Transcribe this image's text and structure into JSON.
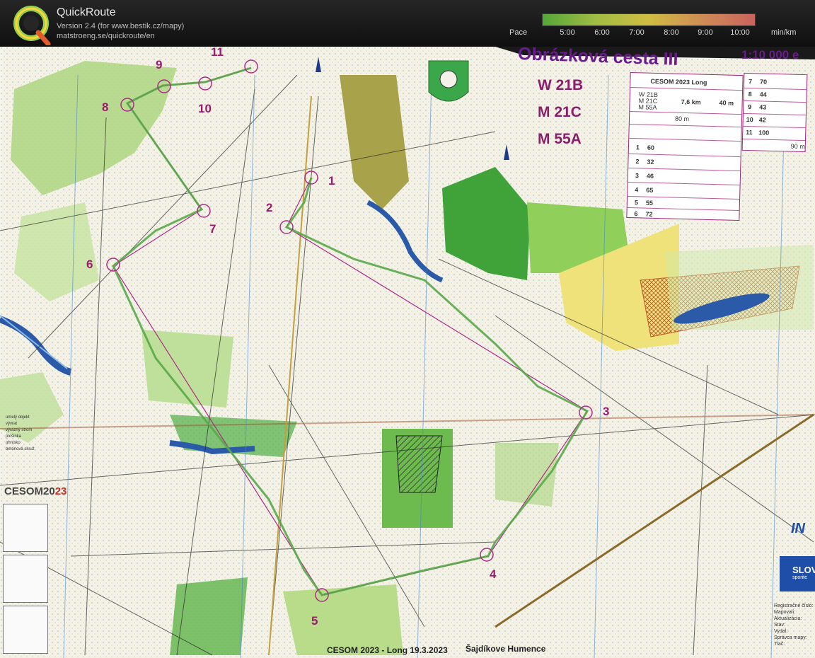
{
  "header": {
    "app_name": "QuickRoute",
    "version": "Version 2.4  (for www.bestik.cz/mapy)",
    "url": "matstroeng.se/quickroute/en",
    "pace_label": "Pace",
    "pace_unit": "min/km",
    "pace_ticks": [
      "5:00",
      "6:00",
      "7:00",
      "8:00",
      "9:00",
      "10:00"
    ],
    "pace_colors": [
      "#5fbf3f",
      "#b8d94a",
      "#f0d94a",
      "#f0a060",
      "#e8706a"
    ]
  },
  "map": {
    "title": "Obrázková cesta III",
    "scale": "1:10 000 e",
    "classes": [
      "W 21B",
      "M 21C",
      "M 55A"
    ],
    "course": {
      "header": "CESOM 2023 Long",
      "classes_small": [
        "W 21B",
        "M 21C",
        "M 55A"
      ],
      "length": "7,6 km",
      "climb": "40 m",
      "start_dist": "80 m",
      "controls": [
        {
          "n": "1",
          "code": "60"
        },
        {
          "n": "2",
          "code": "32"
        },
        {
          "n": "3",
          "code": "46"
        },
        {
          "n": "4",
          "code": "65"
        },
        {
          "n": "5",
          "code": "55"
        },
        {
          "n": "6",
          "code": "72"
        }
      ],
      "controls2": [
        {
          "n": "7",
          "code": "70"
        },
        {
          "n": "8",
          "code": "44"
        },
        {
          "n": "9",
          "code": "43"
        },
        {
          "n": "10",
          "code": "42"
        },
        {
          "n": "11",
          "code": "100"
        }
      ],
      "finish_dist": "90 m"
    },
    "control_numbers": [
      "1",
      "2",
      "3",
      "4",
      "5",
      "6",
      "7",
      "8",
      "9",
      "10",
      "11"
    ],
    "legend": [
      "umelý objekt",
      "vývrat",
      "výrazný strom",
      "plošinka",
      "ohnisko",
      "betónová skruž"
    ],
    "event_logo": "CESOM20",
    "event_logo_accent": "23",
    "footer_event": "CESOM 2023 - Long     19.3.2023",
    "footer_place": "Šajdíkove Humence",
    "sponsor_brand": "IN",
    "sponsor_name": "SLOV",
    "sponsor_sub": "sporite",
    "meta": [
      "Registračné číslo:",
      "Mapovali:",
      "Aktualizácia:",
      "Stav:",
      "Vydal:",
      "Správca mapy:",
      "Tlač:"
    ]
  }
}
